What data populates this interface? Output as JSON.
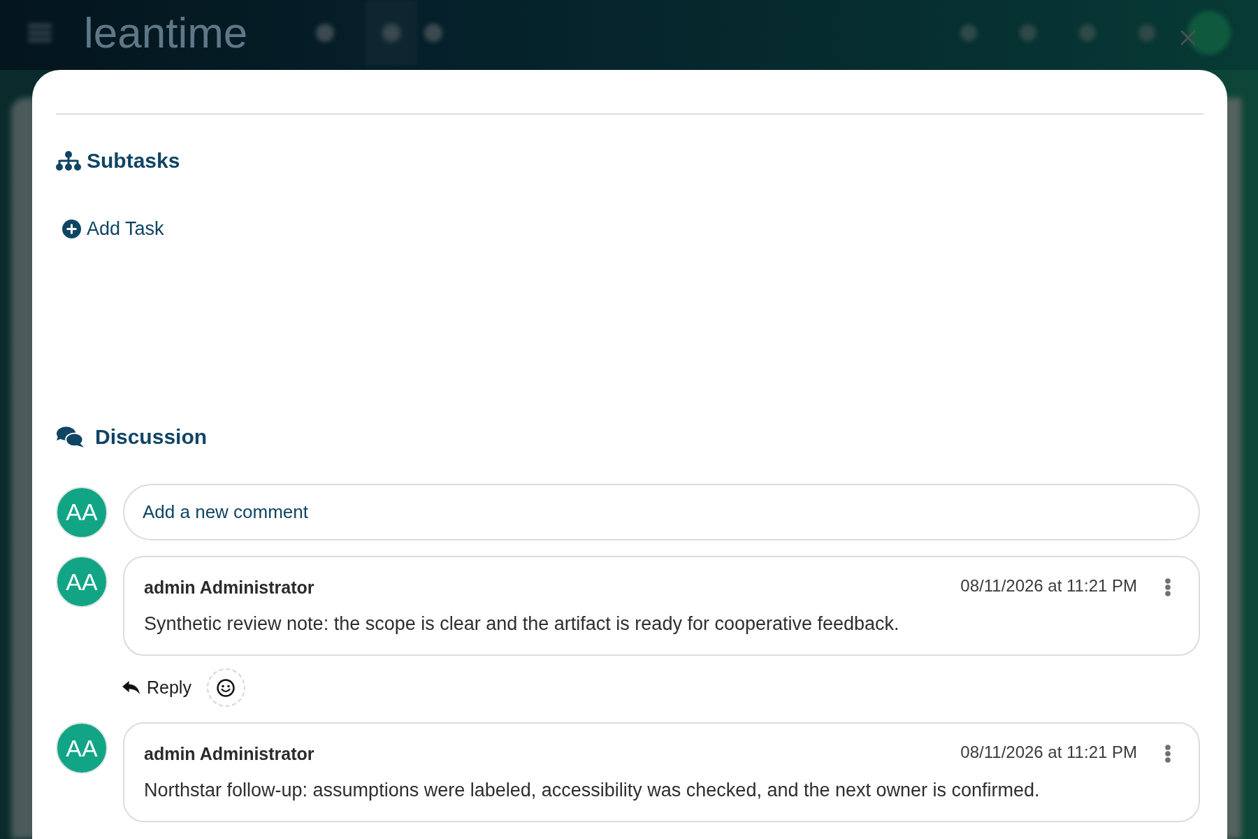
{
  "header": {
    "logo": "leantime"
  },
  "subtasks": {
    "title": "Subtasks",
    "add_button": "Add Task"
  },
  "discussion": {
    "title": "Discussion",
    "new_comment": {
      "avatar": "AA",
      "placeholder": "Add a new comment"
    },
    "comments": [
      {
        "avatar": "AA",
        "author": "admin Administrator",
        "date": "08/11/2026 at 11:21 PM",
        "text": "Synthetic review note: the scope is clear and the artifact is ready for cooperative feedback.",
        "reply": "Reply"
      },
      {
        "avatar": "AA",
        "author": "admin Administrator",
        "date": "08/11/2026 at 11:21 PM",
        "text": "Northstar follow-up: assumptions were labeled, accessibility was checked, and the next owner is confirmed."
      }
    ]
  }
}
